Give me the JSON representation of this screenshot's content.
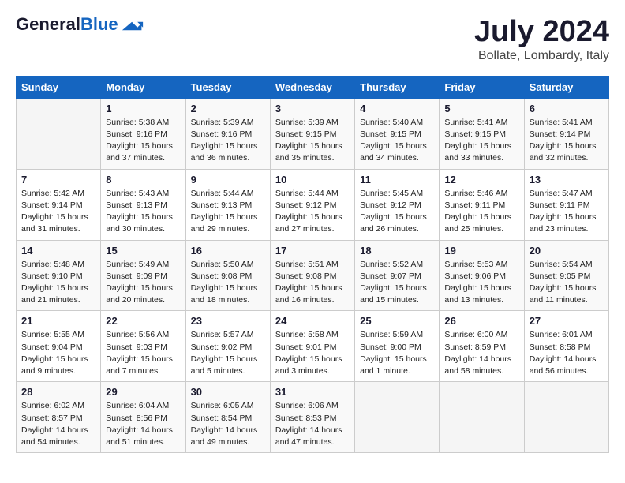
{
  "header": {
    "logo_general": "General",
    "logo_blue": "Blue",
    "month_title": "July 2024",
    "location": "Bollate, Lombardy, Italy"
  },
  "days_of_week": [
    "Sunday",
    "Monday",
    "Tuesday",
    "Wednesday",
    "Thursday",
    "Friday",
    "Saturday"
  ],
  "weeks": [
    [
      {
        "day": "",
        "info": ""
      },
      {
        "day": "1",
        "info": "Sunrise: 5:38 AM\nSunset: 9:16 PM\nDaylight: 15 hours\nand 37 minutes."
      },
      {
        "day": "2",
        "info": "Sunrise: 5:39 AM\nSunset: 9:16 PM\nDaylight: 15 hours\nand 36 minutes."
      },
      {
        "day": "3",
        "info": "Sunrise: 5:39 AM\nSunset: 9:15 PM\nDaylight: 15 hours\nand 35 minutes."
      },
      {
        "day": "4",
        "info": "Sunrise: 5:40 AM\nSunset: 9:15 PM\nDaylight: 15 hours\nand 34 minutes."
      },
      {
        "day": "5",
        "info": "Sunrise: 5:41 AM\nSunset: 9:15 PM\nDaylight: 15 hours\nand 33 minutes."
      },
      {
        "day": "6",
        "info": "Sunrise: 5:41 AM\nSunset: 9:14 PM\nDaylight: 15 hours\nand 32 minutes."
      }
    ],
    [
      {
        "day": "7",
        "info": "Sunrise: 5:42 AM\nSunset: 9:14 PM\nDaylight: 15 hours\nand 31 minutes."
      },
      {
        "day": "8",
        "info": "Sunrise: 5:43 AM\nSunset: 9:13 PM\nDaylight: 15 hours\nand 30 minutes."
      },
      {
        "day": "9",
        "info": "Sunrise: 5:44 AM\nSunset: 9:13 PM\nDaylight: 15 hours\nand 29 minutes."
      },
      {
        "day": "10",
        "info": "Sunrise: 5:44 AM\nSunset: 9:12 PM\nDaylight: 15 hours\nand 27 minutes."
      },
      {
        "day": "11",
        "info": "Sunrise: 5:45 AM\nSunset: 9:12 PM\nDaylight: 15 hours\nand 26 minutes."
      },
      {
        "day": "12",
        "info": "Sunrise: 5:46 AM\nSunset: 9:11 PM\nDaylight: 15 hours\nand 25 minutes."
      },
      {
        "day": "13",
        "info": "Sunrise: 5:47 AM\nSunset: 9:11 PM\nDaylight: 15 hours\nand 23 minutes."
      }
    ],
    [
      {
        "day": "14",
        "info": "Sunrise: 5:48 AM\nSunset: 9:10 PM\nDaylight: 15 hours\nand 21 minutes."
      },
      {
        "day": "15",
        "info": "Sunrise: 5:49 AM\nSunset: 9:09 PM\nDaylight: 15 hours\nand 20 minutes."
      },
      {
        "day": "16",
        "info": "Sunrise: 5:50 AM\nSunset: 9:08 PM\nDaylight: 15 hours\nand 18 minutes."
      },
      {
        "day": "17",
        "info": "Sunrise: 5:51 AM\nSunset: 9:08 PM\nDaylight: 15 hours\nand 16 minutes."
      },
      {
        "day": "18",
        "info": "Sunrise: 5:52 AM\nSunset: 9:07 PM\nDaylight: 15 hours\nand 15 minutes."
      },
      {
        "day": "19",
        "info": "Sunrise: 5:53 AM\nSunset: 9:06 PM\nDaylight: 15 hours\nand 13 minutes."
      },
      {
        "day": "20",
        "info": "Sunrise: 5:54 AM\nSunset: 9:05 PM\nDaylight: 15 hours\nand 11 minutes."
      }
    ],
    [
      {
        "day": "21",
        "info": "Sunrise: 5:55 AM\nSunset: 9:04 PM\nDaylight: 15 hours\nand 9 minutes."
      },
      {
        "day": "22",
        "info": "Sunrise: 5:56 AM\nSunset: 9:03 PM\nDaylight: 15 hours\nand 7 minutes."
      },
      {
        "day": "23",
        "info": "Sunrise: 5:57 AM\nSunset: 9:02 PM\nDaylight: 15 hours\nand 5 minutes."
      },
      {
        "day": "24",
        "info": "Sunrise: 5:58 AM\nSunset: 9:01 PM\nDaylight: 15 hours\nand 3 minutes."
      },
      {
        "day": "25",
        "info": "Sunrise: 5:59 AM\nSunset: 9:00 PM\nDaylight: 15 hours\nand 1 minute."
      },
      {
        "day": "26",
        "info": "Sunrise: 6:00 AM\nSunset: 8:59 PM\nDaylight: 14 hours\nand 58 minutes."
      },
      {
        "day": "27",
        "info": "Sunrise: 6:01 AM\nSunset: 8:58 PM\nDaylight: 14 hours\nand 56 minutes."
      }
    ],
    [
      {
        "day": "28",
        "info": "Sunrise: 6:02 AM\nSunset: 8:57 PM\nDaylight: 14 hours\nand 54 minutes."
      },
      {
        "day": "29",
        "info": "Sunrise: 6:04 AM\nSunset: 8:56 PM\nDaylight: 14 hours\nand 51 minutes."
      },
      {
        "day": "30",
        "info": "Sunrise: 6:05 AM\nSunset: 8:54 PM\nDaylight: 14 hours\nand 49 minutes."
      },
      {
        "day": "31",
        "info": "Sunrise: 6:06 AM\nSunset: 8:53 PM\nDaylight: 14 hours\nand 47 minutes."
      },
      {
        "day": "",
        "info": ""
      },
      {
        "day": "",
        "info": ""
      },
      {
        "day": "",
        "info": ""
      }
    ]
  ]
}
